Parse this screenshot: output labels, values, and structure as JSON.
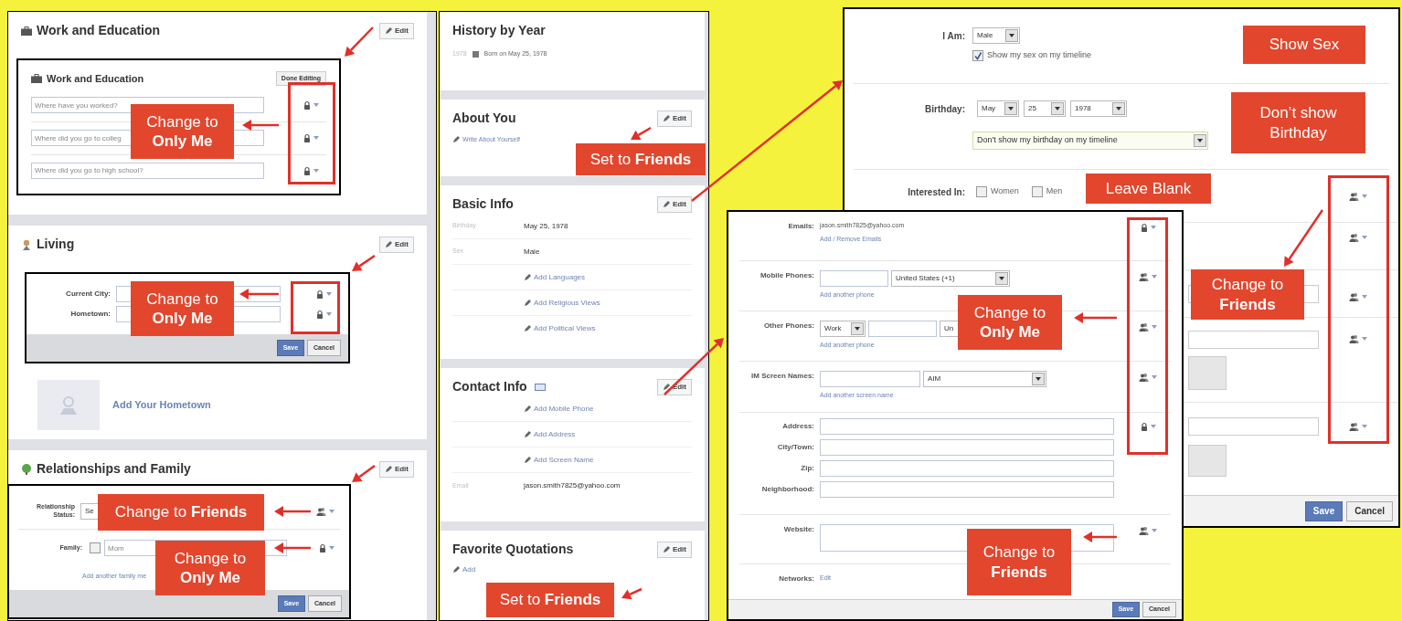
{
  "work_education": {
    "title": "Work and Education",
    "edit": "Edit",
    "editor": {
      "title": "Work and Education",
      "done": "Done Editing",
      "fields": [
        {
          "placeholder": "Where have you worked?",
          "privacy": {
            "kind": "lock"
          }
        },
        {
          "placeholder": "Where did you go to colleg",
          "privacy": {
            "kind": "lock"
          }
        },
        {
          "placeholder": "Where did you go to high school?",
          "privacy": {
            "kind": "lock"
          }
        }
      ]
    },
    "callout": "Change to **Only Me**"
  },
  "living": {
    "title": "Living",
    "edit": "Edit",
    "editor": {
      "fields": [
        {
          "label": "Current City:",
          "privacy": {
            "kind": "lock"
          }
        },
        {
          "label": "Hometown:",
          "privacy": {
            "kind": "lock"
          }
        }
      ],
      "save": "Save",
      "cancel": "Cancel"
    },
    "callout": "Change to **Only Me**",
    "add_link": "Add Your Hometown"
  },
  "relationships": {
    "title": "Relationships and Family",
    "edit": "Edit",
    "editor": {
      "status": {
        "label": "Relationship Status:",
        "value": "Se",
        "privacy": {
          "kind": "friends"
        }
      },
      "family": {
        "label": "Family:",
        "checked": false,
        "placeholder": "Mom",
        "privacy": {
          "kind": "lock"
        }
      },
      "add_link": "Add another family me",
      "save": "Save",
      "cancel": "Cancel"
    },
    "callouts": [
      "Change to **Friends**",
      "Change to **Only Me**"
    ]
  },
  "history": {
    "title": "History by Year",
    "year": "1978",
    "event": "Born on May 25, 1978"
  },
  "about": {
    "title": "About You",
    "edit": "Edit",
    "link": "Write About Yourself",
    "callout": "Set to **Friends**"
  },
  "basic_info": {
    "title": "Basic Info",
    "edit": "Edit",
    "rows": [
      {
        "label": "Birthday",
        "value": "May 25, 1978"
      },
      {
        "label": "Sex",
        "value": "Male"
      }
    ],
    "links": [
      "Add Languages",
      "Add Religious Views",
      "Add Political Views"
    ]
  },
  "contact_info": {
    "title": "Contact Info",
    "edit": "Edit",
    "links": [
      "Add Mobile Phone",
      "Add Address",
      "Add Screen Name"
    ],
    "email_label": "Email",
    "email": "jason.smith7825@yahoo.com"
  },
  "quotations": {
    "title": "Favorite Quotations",
    "edit": "Edit",
    "link": "Add",
    "callout": "Set to **Friends**"
  },
  "basic_editor": {
    "sex_label": "I Am:",
    "sex": "Male",
    "show_sex": {
      "label": "Show my sex on my timeline",
      "checked": true
    },
    "birthday_label": "Birthday:",
    "month": "May",
    "day": "25",
    "year": "1978",
    "birthday_visibility": "Don't show my birthday on my timeline",
    "interested_label": "Interested In:",
    "interests": [
      {
        "label": "Women",
        "checked": false
      },
      {
        "label": "Men",
        "checked": false
      }
    ],
    "privacy": [
      {
        "kind": "friends"
      },
      {
        "kind": "friends"
      },
      {
        "kind": "friends"
      },
      {
        "kind": "friends"
      },
      {
        "kind": "friends"
      }
    ],
    "save": "Save",
    "cancel": "Cancel",
    "callouts": [
      "Show Sex",
      "Don’t show Birthday",
      "Leave Blank",
      "Change to **Friends**"
    ]
  },
  "contact_editor": {
    "emails": {
      "label": "Emails:",
      "value": "jason.smith7825@yahoo.com",
      "link": "Add / Remove Emails",
      "privacy": {
        "kind": "lock"
      }
    },
    "mobile": {
      "label": "Mobile Phones:",
      "country": "United States (+1)",
      "link": "Add another phone",
      "privacy": {
        "kind": "friends"
      }
    },
    "other": {
      "label": "Other Phones:",
      "type": "Work",
      "country": "Un",
      "link": "Add another phone",
      "privacy": {
        "kind": "friends"
      }
    },
    "im": {
      "label": "IM Screen Names:",
      "service": "AIM",
      "link": "Add another screen name",
      "privacy": {
        "kind": "friends"
      }
    },
    "address": {
      "labels": [
        "Address:",
        "City/Town:",
        "Zip:",
        "Neighborhood:"
      ],
      "privacy": {
        "kind": "lock"
      }
    },
    "website": {
      "label": "Website:",
      "privacy": {
        "kind": "friends"
      }
    },
    "networks": {
      "label": "Networks:",
      "link": "Edit"
    },
    "save": "Save",
    "cancel": "Cancel",
    "callouts": [
      "Change to **Only Me**",
      "Change to **Friends**"
    ]
  }
}
